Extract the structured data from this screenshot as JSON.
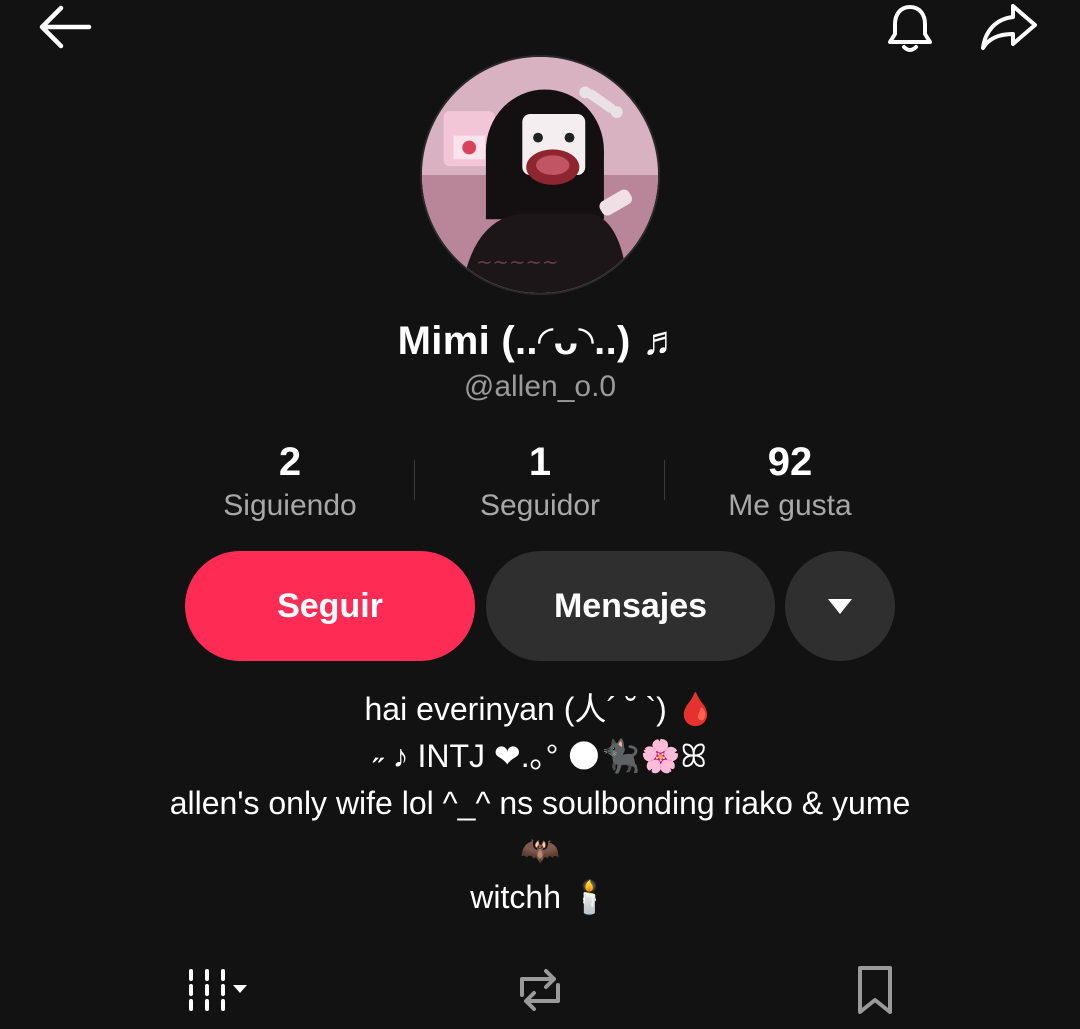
{
  "header": {
    "back_icon": "back-arrow-icon",
    "bell_icon": "bell-icon",
    "share_icon": "share-icon"
  },
  "profile": {
    "avatar_alt": "profile-avatar",
    "display_name": "Mimi (..◜ᴗ◝..) ♬",
    "handle": "@allen_o.0"
  },
  "stats": [
    {
      "value": "2",
      "label": "Siguiendo"
    },
    {
      "value": "1",
      "label": "Seguidor"
    },
    {
      "value": "92",
      "label": "Me gusta"
    }
  ],
  "actions": {
    "follow_label": "Seguir",
    "message_label": "Mensajes",
    "more_icon": "caret-down-icon"
  },
  "bio": {
    "line1": "hai everinyan (人´ ˘ `) 🩸",
    "line2": "˶ ♪ INTJ ❤︎.｡° 🌑🐈‍⬛🌸ꕤ",
    "line3": "allen's only wife lol ^_^  ns soulbonding riako & yume",
    "line4": "🦇",
    "line5": "witchh 🕯️"
  },
  "tabs": {
    "videos_icon": "videos-grid-icon",
    "reposts_icon": "repost-icon",
    "saved_icon": "bookmark-icon"
  },
  "colors": {
    "background": "#121212",
    "accent": "#fe2c55",
    "secondary_button": "#2f2f2f",
    "muted_text": "#9a9a9a"
  }
}
